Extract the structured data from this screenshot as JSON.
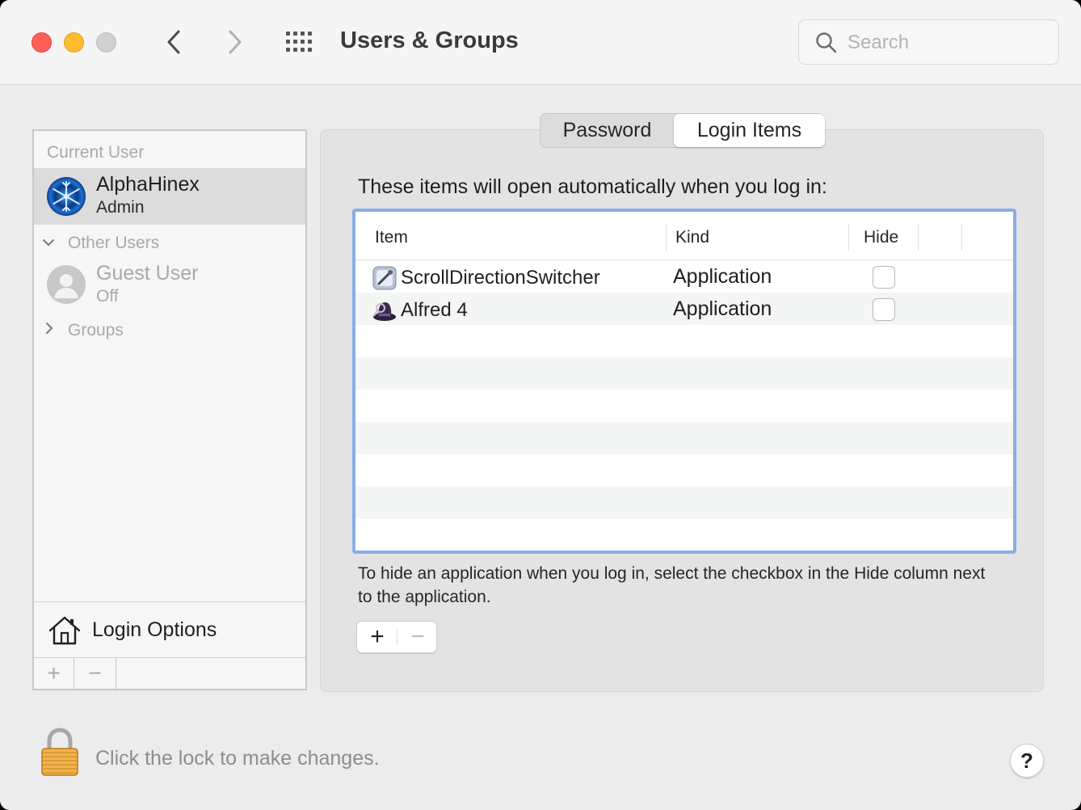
{
  "window": {
    "title": "Users & Groups",
    "search": {
      "placeholder": "Search",
      "value": ""
    }
  },
  "sidebar": {
    "current_user_header": "Current User",
    "current_user": {
      "name": "AlphaHinex",
      "role": "Admin"
    },
    "other_users_header": "Other Users",
    "other_users": [
      {
        "name": "Guest User",
        "status": "Off"
      }
    ],
    "groups_header": "Groups",
    "login_options_label": "Login Options",
    "add_label": "+",
    "remove_label": "−"
  },
  "tabs": {
    "items": [
      {
        "label": "Password",
        "selected": false
      },
      {
        "label": "Login Items",
        "selected": true
      }
    ]
  },
  "login_items": {
    "intro": "These items will open automatically when you log in:",
    "columns": [
      "Item",
      "Kind",
      "Hide"
    ],
    "rows": [
      {
        "name": "ScrollDirectionSwitcher",
        "kind": "Application",
        "hide": false,
        "icon": "scroll-direction-switcher-icon"
      },
      {
        "name": "Alfred 4",
        "kind": "Application",
        "hide": false,
        "icon": "alfred-icon"
      }
    ],
    "hint": "To hide an application when you log in, select the checkbox in the Hide column next to the application.",
    "add_label": "+",
    "remove_label": "−"
  },
  "footer": {
    "lock_text": "Click the lock to make changes.",
    "help_label": "?"
  },
  "colors": {
    "close": "#fe5f57",
    "minimize": "#febc2e",
    "focus_ring": "#8aaee6",
    "selected_row": "#dcdcdc"
  }
}
